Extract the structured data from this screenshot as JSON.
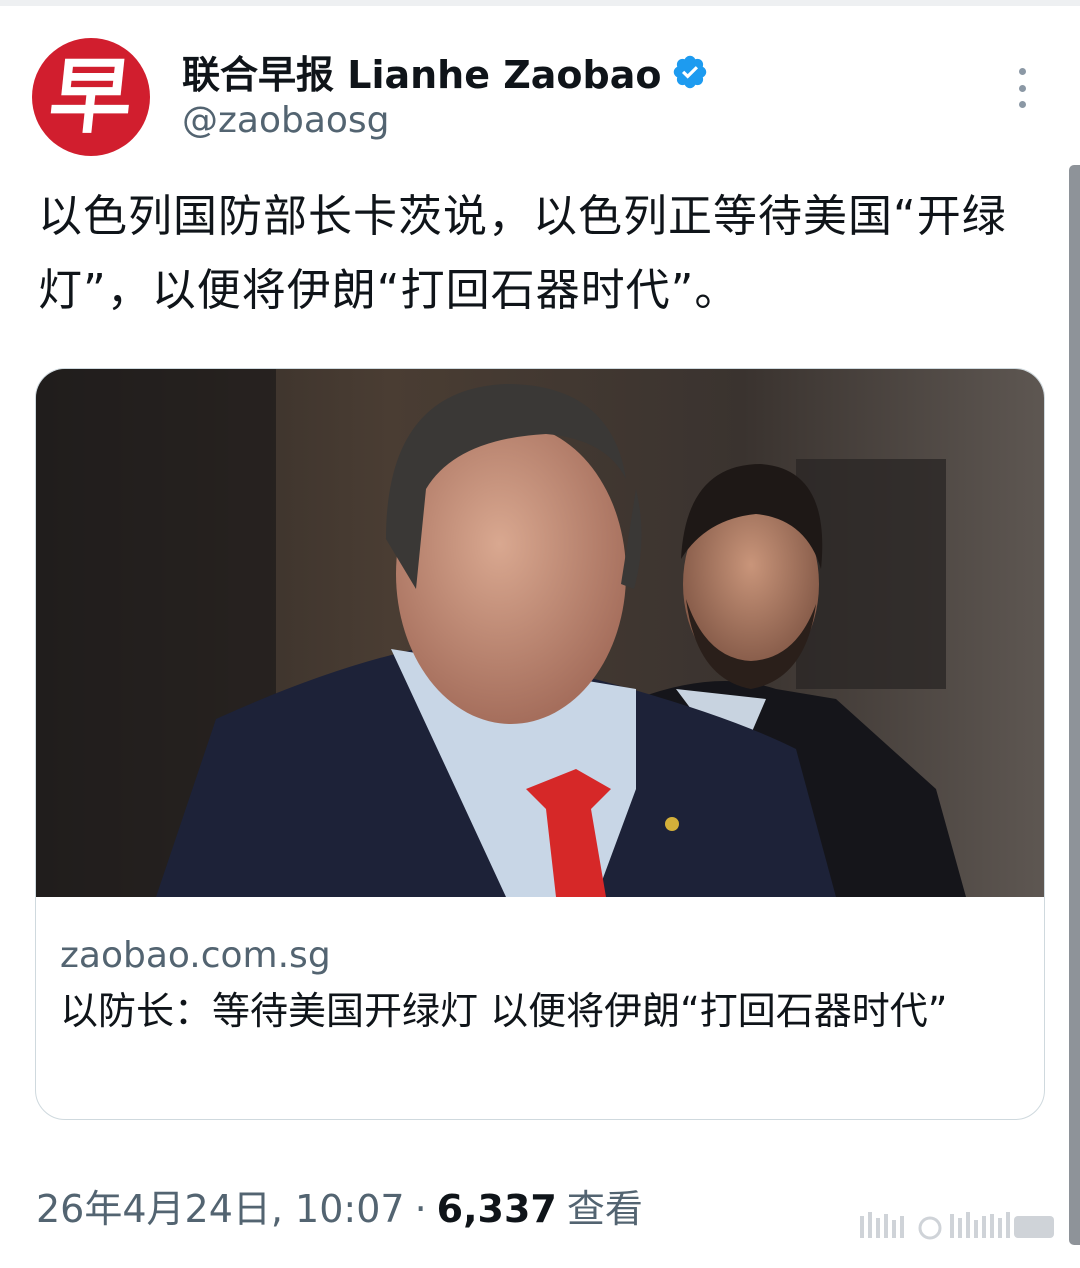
{
  "account": {
    "display_name": "联合早报 Lianhe Zaobao",
    "handle": "@zaobaosg",
    "avatar_glyph": "早",
    "avatar_color": "#d11e2e",
    "verified_color": "#1d9bf0",
    "verified_icon": "verified-badge-icon"
  },
  "more_icon": "more-options-icon",
  "tweet": {
    "text": "以色列国防部长卡茨说，以色列正等待美国“开绿灯”，以便将伊朗“打回石器时代”。"
  },
  "card": {
    "image": "photo of two men in suits",
    "domain": "zaobao.com.sg",
    "title": "以防长：等待美国开绿灯 以便将伊朗“打回石器时代”"
  },
  "meta": {
    "timestamp": "26年4月24日, 10:07",
    "separator": "·",
    "views_count": "6,337",
    "views_label": "查看"
  },
  "colors": {
    "secondary_text": "#536471",
    "primary_text": "#0f1419",
    "border": "#cfd9de",
    "tie": "#d62828"
  }
}
